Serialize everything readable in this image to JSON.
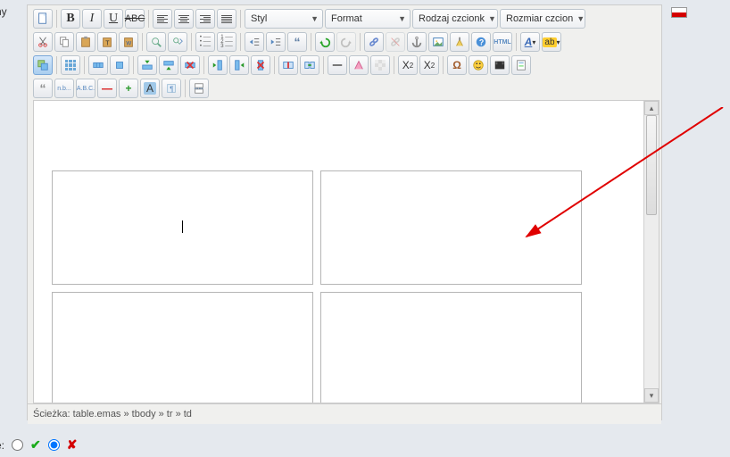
{
  "labels": {
    "left_partial": "ny",
    "bottom_partial": "e:"
  },
  "dropdowns": {
    "style": "Styl",
    "format": "Format",
    "font_family": "Rodzaj czcionk",
    "font_size": "Rozmiar czcion"
  },
  "format_chars": {
    "bold": "B",
    "italic": "I",
    "underline": "U",
    "strike": "ABC",
    "sub": "X",
    "sub_s": "2",
    "sup": "X",
    "sup_s": "2",
    "omega": "Ω",
    "text_color": "A",
    "highlight": "ab",
    "html_label": "HTML",
    "nbsp": "n.b...",
    "abc_label": "A.B.C.",
    "A_plain": "A"
  },
  "statusbar": {
    "path": "Ścieżka: table.emas » tbody » tr » td"
  },
  "locale_flag": "pl-PL"
}
